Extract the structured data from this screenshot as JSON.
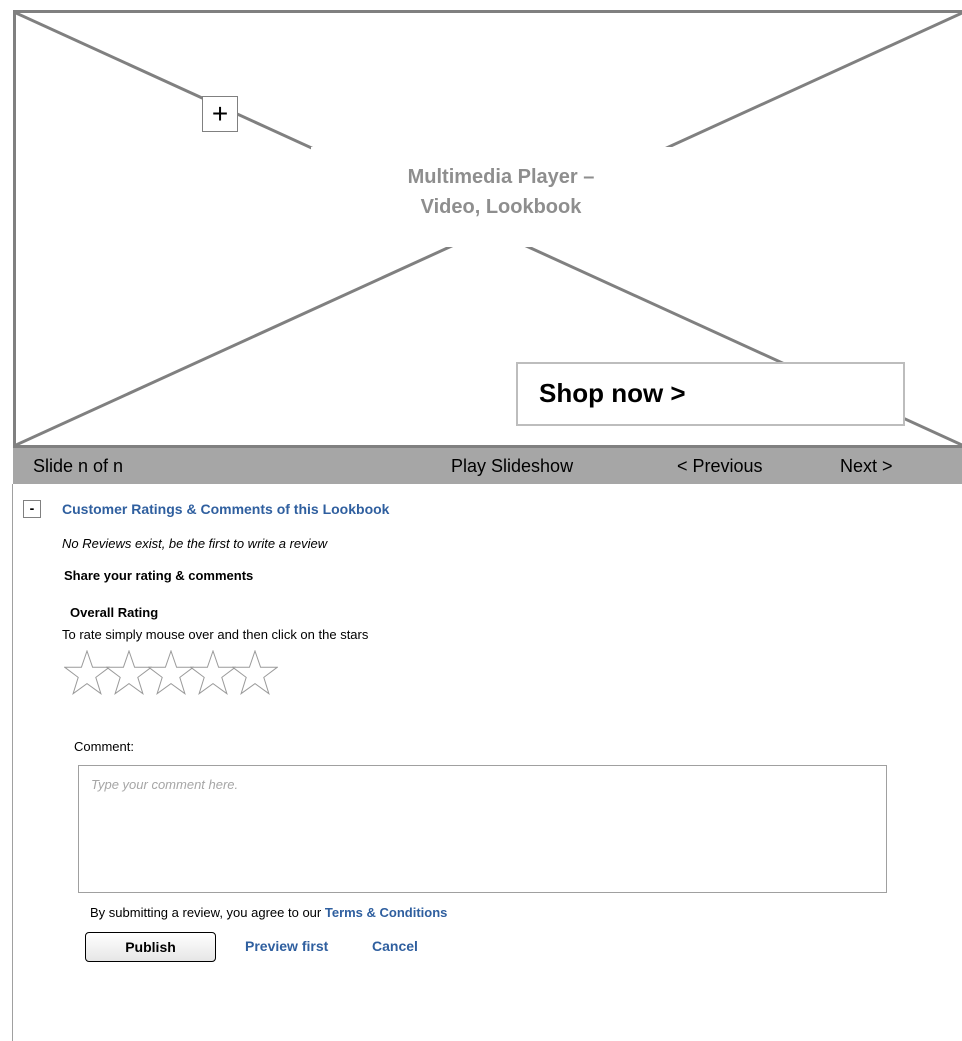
{
  "player": {
    "title_line1": "Multimedia Player –",
    "title_line2": "Video, Lookbook",
    "zoom_symbol": "+",
    "shop_label": "Shop now >"
  },
  "slidebar": {
    "slide_counter": "Slide n of n",
    "play_label": "Play Slideshow",
    "previous_label": "< Previous",
    "next_label": "Next >"
  },
  "reviews": {
    "collapse_symbol": "-",
    "section_title": "Customer Ratings & Comments of this Lookbook",
    "no_reviews_text": "No Reviews exist, be the first to write a review",
    "share_title": "Share your rating & comments",
    "rating_label": "Overall Rating",
    "rating_help": "To rate simply mouse over and then click on the stars",
    "star_count": 5,
    "selected_rating": 0,
    "comment_label": "Comment:",
    "comment_placeholder": "Type your comment here.",
    "comment_value": "",
    "terms_prefix": "By submitting a review, you agree to our ",
    "terms_link": "Terms & Conditions",
    "publish_label": "Publish",
    "preview_label": "Preview first",
    "cancel_label": "Cancel"
  },
  "colors": {
    "link": "#2f5f9f",
    "slidebar_bg": "#a6a6a6",
    "placeholder_border": "#808080"
  }
}
